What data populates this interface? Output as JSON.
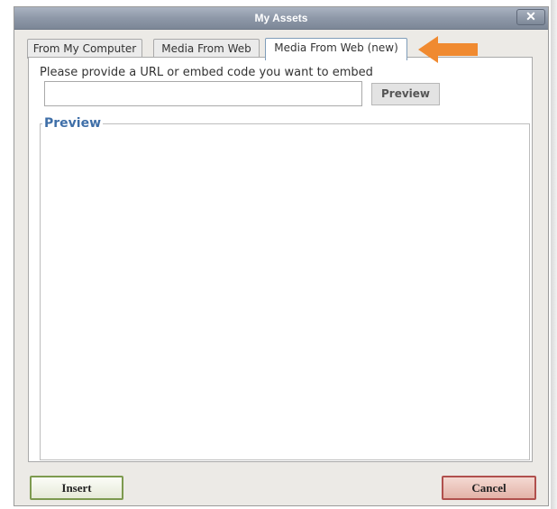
{
  "window": {
    "title": "My Assets",
    "close_icon": "close-icon"
  },
  "tabs": [
    {
      "label": "From My Computer",
      "active": false
    },
    {
      "label": "Media From Web",
      "active": false
    },
    {
      "label": "Media From Web (new)",
      "active": true
    }
  ],
  "form": {
    "prompt": "Please provide a URL or embed code you want to embed",
    "url_value": "",
    "url_placeholder": "",
    "preview_button": "Preview"
  },
  "preview_section": {
    "legend": "Preview"
  },
  "footer": {
    "insert_label": "Insert",
    "cancel_label": "Cancel"
  },
  "annotation": {
    "icon": "arrow-left-icon",
    "color": "#f08a30"
  },
  "colors": {
    "titlebar": "#8e98a8",
    "legend_text": "#3f6fa8",
    "insert_border": "#7d9a4f",
    "cancel_border": "#b0504d"
  }
}
